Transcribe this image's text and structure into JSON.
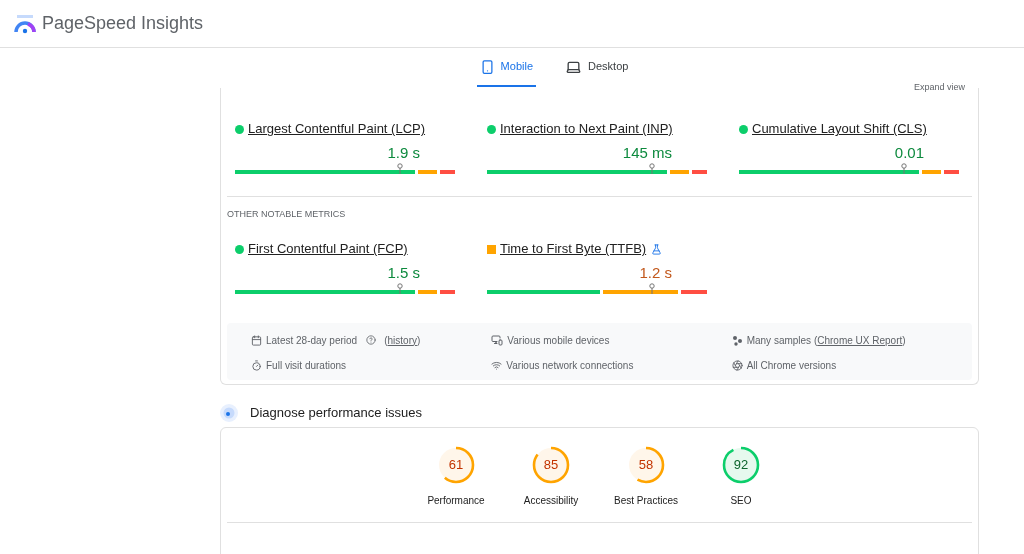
{
  "header": {
    "title": "PageSpeed Insights"
  },
  "tabs": [
    {
      "label": "Mobile",
      "kind": "phone",
      "selected": true
    },
    {
      "label": "Desktop",
      "kind": "laptop",
      "selected": false
    }
  ],
  "expand_link": "Expand view",
  "core_metrics": [
    {
      "name": "Largest Contentful Paint (LCP)",
      "kind": "good",
      "value": "1.9 s"
    },
    {
      "name": "Interaction to Next Paint (INP)",
      "kind": "good",
      "value": "145 ms"
    },
    {
      "name": "Cumulative Layout Shift (CLS)",
      "kind": "good",
      "value": "0.01"
    }
  ],
  "other_section": {
    "title": "OTHER NOTABLE METRICS",
    "metrics": [
      {
        "name": "First Contentful Paint (FCP)",
        "kind": "good",
        "value": "1.5 s",
        "experimental": false
      },
      {
        "name": "Time to First Byte (TTFB)",
        "kind": "needs_improvement",
        "value": "1.2 s",
        "experimental": true
      }
    ]
  },
  "info_items": [
    {
      "kind": "calendar",
      "text": "Latest 28-day period",
      "help": true,
      "link_before": "(",
      "link": "history",
      "link_after": ")"
    },
    {
      "kind": "devices",
      "text": "Various mobile devices",
      "help": false
    },
    {
      "kind": "samples",
      "text": "Many samples (",
      "help": false,
      "link": "Chrome UX Report",
      "link_after": ")"
    },
    {
      "kind": "timer",
      "text": "Full visit durations",
      "help": false
    },
    {
      "kind": "network",
      "text": "Various network connections",
      "help": false
    },
    {
      "kind": "browser",
      "text": "All Chrome versions",
      "help": false
    }
  ],
  "diagnose": {
    "title": "Diagnose performance issues"
  },
  "scores": [
    {
      "label": "Performance",
      "score": "61",
      "kind": "average"
    },
    {
      "label": "Accessibility",
      "score": "85",
      "kind": "average"
    },
    {
      "label": "Best Practices",
      "score": "58",
      "kind": "average"
    },
    {
      "label": "SEO",
      "score": "92",
      "kind": "pass"
    }
  ]
}
